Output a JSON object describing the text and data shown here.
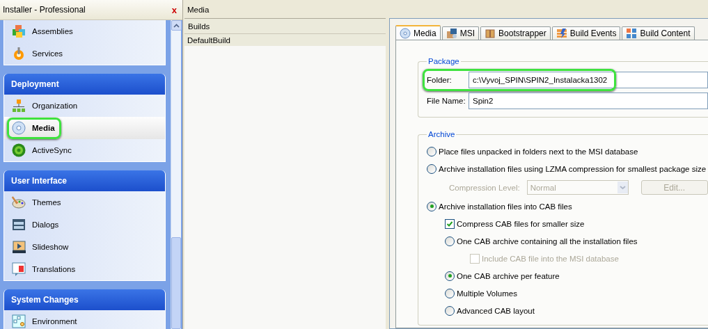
{
  "window": {
    "title": "Installer - Professional",
    "close": "x"
  },
  "sidebar": {
    "groups": [
      {
        "items": [
          {
            "label": "Assemblies",
            "selected": false,
            "highlighted": false
          },
          {
            "label": "Services",
            "selected": false,
            "highlighted": false
          }
        ]
      },
      {
        "title": "Deployment",
        "items": [
          {
            "label": "Organization",
            "selected": false,
            "highlighted": false
          },
          {
            "label": "Media",
            "selected": true,
            "highlighted": true
          },
          {
            "label": "ActiveSync",
            "selected": false,
            "highlighted": false
          }
        ]
      },
      {
        "title": "User Interface",
        "items": [
          {
            "label": "Themes",
            "selected": false,
            "highlighted": false
          },
          {
            "label": "Dialogs",
            "selected": false,
            "highlighted": false
          },
          {
            "label": "Slideshow",
            "selected": false,
            "highlighted": false
          },
          {
            "label": "Translations",
            "selected": false,
            "highlighted": false
          }
        ]
      },
      {
        "title": "System Changes",
        "items": [
          {
            "label": "Environment",
            "selected": false,
            "highlighted": false
          }
        ]
      }
    ]
  },
  "page": {
    "title": "Media"
  },
  "builds": {
    "header": "Builds",
    "rows": [
      {
        "label": "DefaultBuild",
        "selected": true
      }
    ]
  },
  "tabs": [
    {
      "label": "Media",
      "selected": true
    },
    {
      "label": "MSI",
      "selected": false
    },
    {
      "label": "Bootstrapper",
      "selected": false
    },
    {
      "label": "Build Events",
      "selected": false
    },
    {
      "label": "Build Content",
      "selected": false
    }
  ],
  "package": {
    "title": "Package",
    "fields": [
      {
        "label": "Folder:",
        "value": "c:\\Vyvoj_SPIN\\SPIN2_Instalacka1302",
        "highlighted": true
      },
      {
        "label": "File Name:",
        "value": "Spin2",
        "highlighted": false
      }
    ]
  },
  "archive": {
    "title": "Archive",
    "options": [
      {
        "kind": "radio",
        "label": "Place files unpacked in folders next to the MSI database",
        "selected": false
      },
      {
        "kind": "radio",
        "label": "Archive installation files using LZMA compression for smallest package size",
        "selected": false,
        "children": [
          {
            "kind": "compression",
            "label": "Compression Level:",
            "value": "Normal",
            "button": "Edit...",
            "disabled": true
          }
        ]
      },
      {
        "kind": "radio",
        "label": "Archive installation files into CAB files",
        "selected": true,
        "children": [
          {
            "kind": "checkbox",
            "label": "Compress CAB files for smaller size",
            "checked": true,
            "disabled": false
          },
          {
            "kind": "radio",
            "label": "One CAB archive containing all the installation files",
            "selected": false,
            "children": [
              {
                "kind": "checkbox",
                "label": "Include CAB file into the MSI database",
                "checked": false,
                "disabled": true
              }
            ]
          },
          {
            "kind": "radio",
            "label": "One CAB archive per feature",
            "selected": true
          },
          {
            "kind": "radio",
            "label": "Multiple Volumes",
            "selected": false
          },
          {
            "kind": "radio",
            "label": "Advanced CAB layout",
            "selected": false
          }
        ]
      }
    ]
  }
}
